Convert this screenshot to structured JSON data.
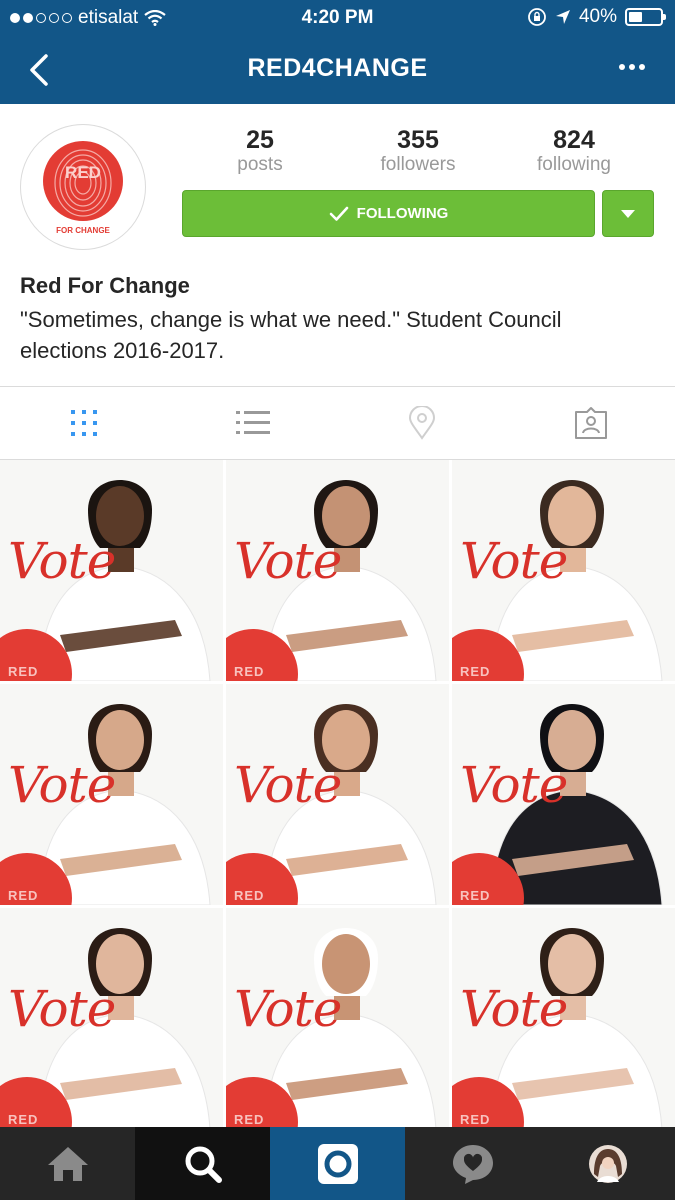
{
  "status_bar": {
    "carrier": "etisalat",
    "time": "4:20 PM",
    "battery": "40%"
  },
  "header": {
    "title": "RED4CHANGE",
    "back_icon": "chevron-left-icon",
    "more_icon": "more-horizontal-icon"
  },
  "profile": {
    "avatar_text_top": "RED",
    "avatar_text_bottom": "FOR CHANGE",
    "stats": [
      {
        "value": "25",
        "label": "posts"
      },
      {
        "value": "355",
        "label": "followers"
      },
      {
        "value": "824",
        "label": "following"
      }
    ],
    "follow_label": "FOLLOWING",
    "name": "Red For Change",
    "bio": "\"Sometimes, change is what we need.\" Student Council elections 2016-2017."
  },
  "tabs": [
    {
      "name": "grid-view",
      "icon": "grid-icon",
      "active": true
    },
    {
      "name": "list-view",
      "icon": "list-icon",
      "active": false
    },
    {
      "name": "places",
      "icon": "location-pin-icon",
      "active": false
    },
    {
      "name": "tagged",
      "icon": "tagged-photos-icon",
      "active": false
    }
  ],
  "posts": [
    {
      "overlay": "Vote",
      "badge": "RED"
    },
    {
      "overlay": "Vote",
      "badge": "RED"
    },
    {
      "overlay": "Vote",
      "badge": "RED"
    },
    {
      "overlay": "Vote",
      "badge": "RED"
    },
    {
      "overlay": "Vote",
      "badge": "RED"
    },
    {
      "overlay": "Vote",
      "badge": "RED"
    },
    {
      "overlay": "Vote",
      "badge": "RED"
    },
    {
      "overlay": "Vote",
      "badge": "RED"
    },
    {
      "overlay": "Vote",
      "badge": "RED"
    }
  ],
  "bottom_nav": [
    {
      "name": "home",
      "icon": "home-icon"
    },
    {
      "name": "search",
      "icon": "search-icon"
    },
    {
      "name": "camera",
      "icon": "camera-icon"
    },
    {
      "name": "activity",
      "icon": "heart-bubble-icon"
    },
    {
      "name": "profile",
      "icon": "avatar-icon"
    }
  ],
  "colors": {
    "header_bg": "#125688",
    "follow_green": "#6cbe38",
    "brand_red": "#e33c34",
    "tab_active_blue": "#3897f0",
    "tab_inactive_gray": "#999999",
    "bottom_bar_bg": "#262626"
  }
}
